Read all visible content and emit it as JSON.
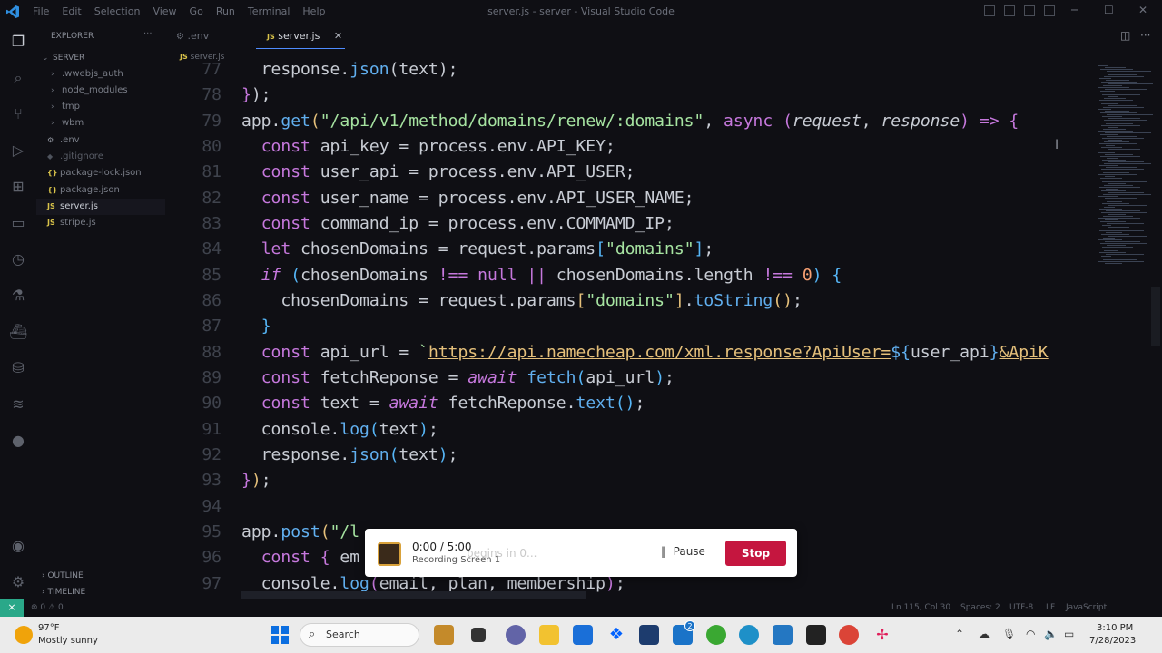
{
  "window": {
    "title": "server.js - server - Visual Studio Code",
    "menu": [
      "File",
      "Edit",
      "Selection",
      "View",
      "Go",
      "Run",
      "Terminal",
      "Help"
    ]
  },
  "sidebar": {
    "header": "EXPLORER",
    "root": "SERVER",
    "items": [
      {
        "label": ".wwebjs_auth",
        "type": "folder"
      },
      {
        "label": "node_modules",
        "type": "folder"
      },
      {
        "label": "tmp",
        "type": "folder"
      },
      {
        "label": "wbm",
        "type": "folder"
      },
      {
        "label": ".env",
        "type": "env"
      },
      {
        "label": ".gitignore",
        "type": "git"
      },
      {
        "label": "package-lock.json",
        "type": "json"
      },
      {
        "label": "package.json",
        "type": "json"
      },
      {
        "label": "server.js",
        "type": "js"
      },
      {
        "label": "stripe.js",
        "type": "js"
      }
    ],
    "outline": "OUTLINE",
    "timeline": "TIMELINE"
  },
  "tabs": [
    {
      "label": ".env",
      "icon": "gear-icon"
    },
    {
      "label": "server.js",
      "icon": "JS"
    }
  ],
  "breadcrumb": "server.js",
  "editor": {
    "line_numbers": [
      "77",
      "78",
      "79",
      "80",
      "81",
      "82",
      "83",
      "84",
      "85",
      "86",
      "87",
      "88",
      "89",
      "90",
      "91",
      "92",
      "93",
      "94",
      "95",
      "96",
      "97"
    ]
  },
  "recorder": {
    "time": "0:00 / 5:00",
    "name": "Recording Screen 1",
    "ghost": "begins in 0...",
    "pause": "Pause",
    "stop": "Stop"
  },
  "status": {
    "errors": "0",
    "warnings": "0",
    "position": "Ln 115, Col 30",
    "spaces": "Spaces: 2",
    "encoding": "UTF-8",
    "eol": "LF",
    "language": "JavaScript"
  },
  "taskbar": {
    "temp": "97°F",
    "weather": "Mostly sunny",
    "search": "Search",
    "time": "3:10 PM",
    "date": "7/28/2023",
    "mail_badge": "2"
  }
}
